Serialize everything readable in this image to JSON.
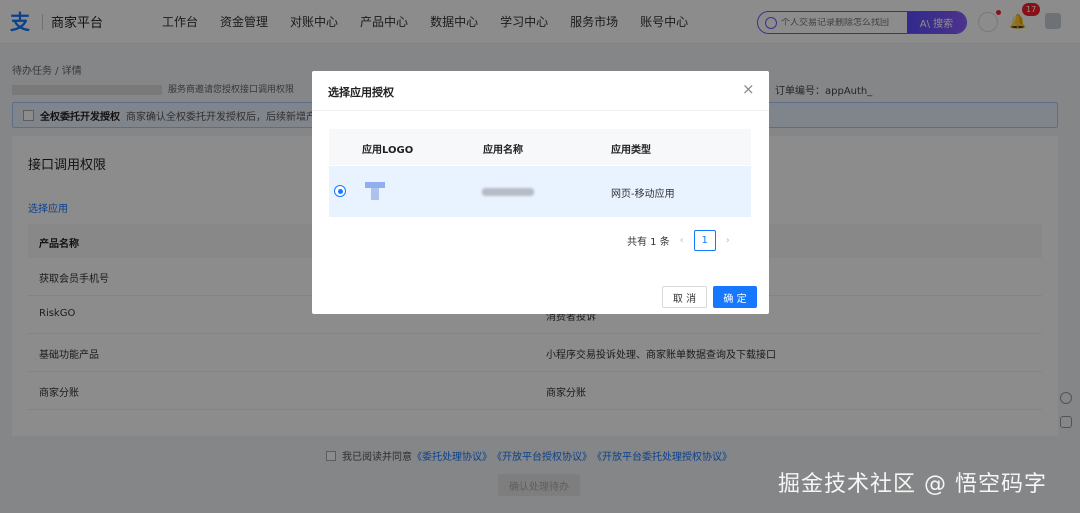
{
  "header": {
    "logo_glyph": "支",
    "logo_text": "商家平台",
    "nav": [
      "工作台",
      "资金管理",
      "对账中心",
      "产品中心",
      "数据中心",
      "学习中心",
      "服务市场",
      "账号中心"
    ],
    "search_placeholder": "个人交易记录删除怎么找回",
    "search_button": "A\\ 搜索",
    "notification_count": "17"
  },
  "page": {
    "breadcrumb": "待办任务 / 详情",
    "info_text": "服务商邀请您授权接口调用权限",
    "order_label": "订单编号：appAuth_",
    "notice_title": "全权委托开发授权",
    "notice_text": "商家确认全权委托开发授权后，后续新增产品",
    "card_title": "接口调用权限",
    "select_app_link": "选择应用",
    "column_product": "产品名称",
    "rows": [
      {
        "name": "获取会员手机号",
        "desc": ""
      },
      {
        "name": "RiskGO",
        "desc": "消费者投诉"
      },
      {
        "name": "基础功能产品",
        "desc": "小程序交易投诉处理、商家账单数据查询及下载接口"
      },
      {
        "name": "商家分账",
        "desc": "商家分账"
      }
    ],
    "agree_prefix": "我已阅读并同意",
    "agree_links": [
      "《委托处理协议》",
      "《开放平台授权协议》",
      "《开放平台委托处理授权协议》"
    ],
    "confirm_button": "确认处理待办"
  },
  "modal": {
    "title": "选择应用授权",
    "close_glyph": "×",
    "columns": [
      "应用LOGO",
      "应用名称",
      "应用类型"
    ],
    "row": {
      "type": "网页-移动应用",
      "selected": true
    },
    "pagination": {
      "total_text": "共有 1 条",
      "current_page": "1",
      "prev_glyph": "‹",
      "next_glyph": "›"
    },
    "cancel_label": "取 消",
    "ok_label": "确 定"
  },
  "watermark": "掘金技术社区 @ 悟空码字",
  "colors": {
    "primary": "#1677ff",
    "search_accent": "#6a5cff",
    "badge": "#f5222d"
  }
}
